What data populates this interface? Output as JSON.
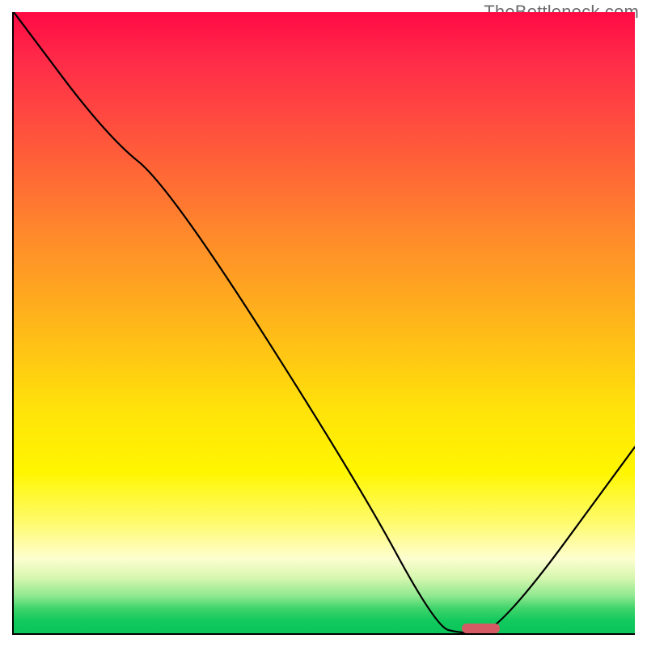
{
  "watermark": "TheBottleneck.com",
  "chart_data": {
    "type": "line",
    "title": "",
    "xlabel": "",
    "ylabel": "",
    "xlim": [
      0,
      100
    ],
    "ylim": [
      0,
      100
    ],
    "grid": false,
    "legend": false,
    "background": "heatmap-gradient",
    "series": [
      {
        "name": "bottleneck-curve",
        "x": [
          0,
          15,
          25,
          55,
          68,
          72,
          78,
          100
        ],
        "y": [
          100,
          80,
          72,
          25,
          1,
          0,
          0,
          30
        ]
      }
    ],
    "marker": {
      "name": "optimal-point",
      "x_start": 72,
      "x_end": 78,
      "y": 0,
      "color": "#d65a63"
    },
    "gradient_stops": [
      {
        "pos": 0,
        "color": "#ff0a44"
      },
      {
        "pos": 8,
        "color": "#ff2c49"
      },
      {
        "pos": 22,
        "color": "#ff5a3a"
      },
      {
        "pos": 36,
        "color": "#ff8a2b"
      },
      {
        "pos": 50,
        "color": "#ffb61a"
      },
      {
        "pos": 64,
        "color": "#ffe30a"
      },
      {
        "pos": 74,
        "color": "#fff600"
      },
      {
        "pos": 82,
        "color": "#fffb6a"
      },
      {
        "pos": 88,
        "color": "#fdfed0"
      },
      {
        "pos": 91,
        "color": "#d8f7b0"
      },
      {
        "pos": 94,
        "color": "#8fe88f"
      },
      {
        "pos": 96,
        "color": "#3fd46b"
      },
      {
        "pos": 98,
        "color": "#12c95d"
      },
      {
        "pos": 100,
        "color": "#0ac55a"
      }
    ]
  }
}
